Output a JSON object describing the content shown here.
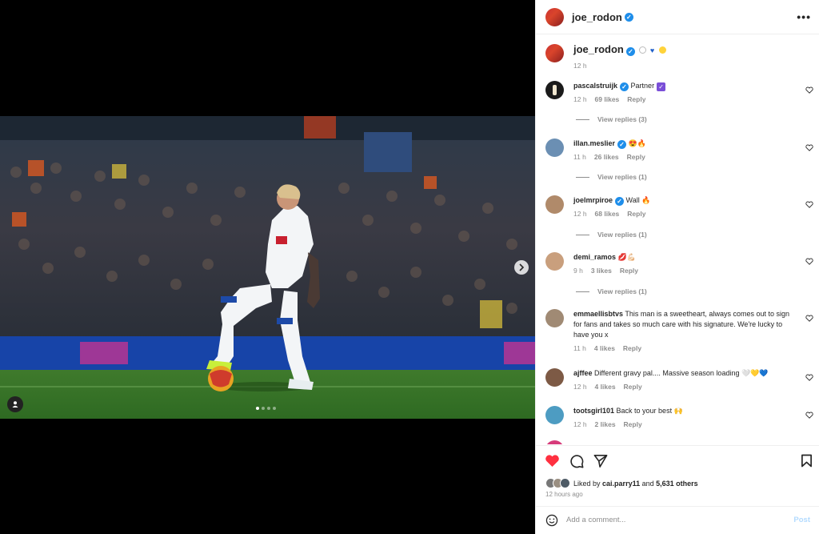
{
  "post": {
    "author": "joe_rodon",
    "more_icon": "ellipsis-icon",
    "carousel": {
      "slides": 4,
      "active": 1
    }
  },
  "caption": {
    "username": "joe_rodon",
    "emojis": [
      "white-circle",
      "blue-heart",
      "yellow-circle"
    ],
    "time": "12 h"
  },
  "comments": [
    {
      "username": "pascalstruijk",
      "text": "Partner",
      "badge": "purple-check",
      "time": "12 h",
      "likes": "69 likes",
      "reply": "Reply",
      "replies": "View replies (3)",
      "avatar_color": "#1a1a1a"
    },
    {
      "username": "illan.meslier",
      "text": "😍🔥",
      "time": "11 h",
      "likes": "26 likes",
      "reply": "Reply",
      "replies": "View replies (1)",
      "avatar_color": "#6b8fb3"
    },
    {
      "username": "joelmrpiroe",
      "text": "Wall 🔥",
      "time": "12 h",
      "likes": "68 likes",
      "reply": "Reply",
      "replies": "View replies (1)",
      "avatar_color": "#b08a6a"
    },
    {
      "username": "demi_ramos",
      "text": "💋💪🏻",
      "time": "9 h",
      "likes": "3 likes",
      "reply": "Reply",
      "replies": "View replies (1)",
      "avatar_color": "#c99f7d"
    },
    {
      "username": "emmaellisbtvs",
      "text": "This man is a sweetheart, always comes out to sign for fans and takes so much care with his signature. We're lucky to have you x",
      "time": "11 h",
      "likes": "4 likes",
      "reply": "Reply",
      "avatar_color": "#a08a74"
    },
    {
      "username": "ajffee",
      "text": "Different gravy pal.... Massive season loading 🤍💛💙",
      "time": "12 h",
      "likes": "4 likes",
      "reply": "Reply",
      "avatar_color": "#7d5a45"
    },
    {
      "username": "tootsgirl101",
      "text": "Back to your best 🙌",
      "time": "12 h",
      "likes": "2 likes",
      "reply": "Reply",
      "avatar_color": "#4d9cc2"
    }
  ],
  "actions": {
    "like_icon": "heart-filled-icon",
    "comment_icon": "comment-icon",
    "share_icon": "send-icon",
    "save_icon": "bookmark-icon",
    "liked_by_prefix": "Liked by",
    "liked_by_user": "cai.parry11",
    "and": "and",
    "others": "5,631 others",
    "time_ago": "12 hours ago"
  },
  "composer": {
    "emoji_icon": "smile-icon",
    "placeholder": "Add a comment...",
    "post_label": "Post"
  },
  "colors": {
    "like_red": "#ff3040",
    "verified_blue": "#1f8eea",
    "muted": "#8e8e8e"
  }
}
